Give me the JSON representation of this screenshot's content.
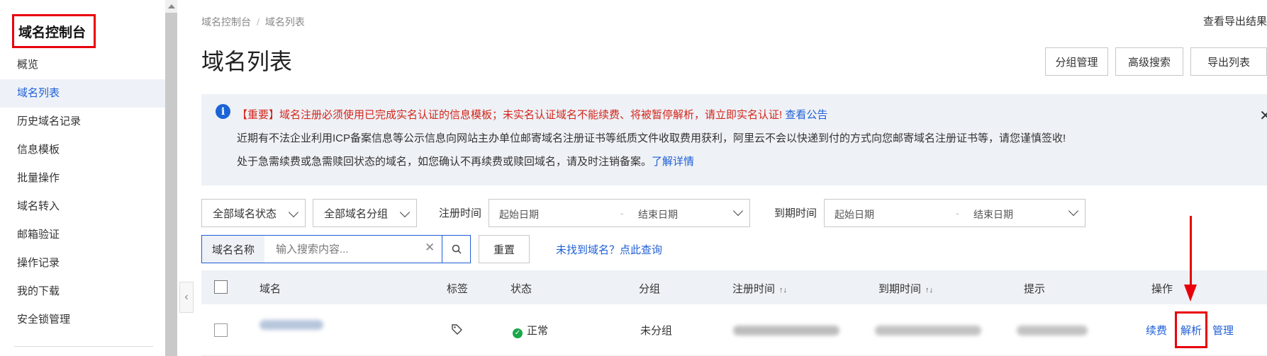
{
  "sidebar": {
    "title": "域名控制台",
    "items": [
      {
        "label": "概览"
      },
      {
        "label": "域名列表"
      },
      {
        "label": "历史域名记录"
      },
      {
        "label": "信息模板"
      },
      {
        "label": "批量操作"
      },
      {
        "label": "域名转入"
      },
      {
        "label": "邮箱验证"
      },
      {
        "label": "操作记录"
      },
      {
        "label": "我的下载"
      },
      {
        "label": "安全锁管理"
      }
    ]
  },
  "breadcrumb": {
    "root": "域名控制台",
    "sep": "/",
    "current": "域名列表"
  },
  "header": {
    "title": "域名列表",
    "export_results": "查看导出结果",
    "group_manage": "分组管理",
    "advanced_search": "高级搜索",
    "export_list": "导出列表"
  },
  "notice": {
    "line1": "【重要】域名注册必须使用已完成实名认证的信息模板；未实名认证域名不能续费、将被暂停解析，请立即实名认证!",
    "line1_link": "查看公告",
    "line2": "近期有不法企业利用ICP备案信息等公示信息向网站主办单位邮寄域名注册证书等纸质文件收取费用获利，阿里云不会以快递到付的方式向您邮寄域名注册证书等，请您谨慎签收!",
    "line3": "处于急需续费或急需赎回状态的域名，如您确认不再续费或赎回域名，请及时注销备案。",
    "line3_link": "了解详情"
  },
  "filters": {
    "status": "全部域名状态",
    "group": "全部域名分组",
    "reg_time_label": "注册时间",
    "exp_time_label": "到期时间",
    "start_date": "起始日期",
    "end_date": "结束日期",
    "dash": "-",
    "search_label": "域名名称",
    "search_placeholder": "输入搜索内容...",
    "reset": "重置",
    "not_found": "未找到域名？点此查询"
  },
  "table": {
    "headers": {
      "domain": "域名",
      "tags": "标签",
      "status": "状态",
      "group": "分组",
      "reg_time": "注册时间",
      "exp_time": "到期时间",
      "hint": "提示",
      "actions": "操作"
    },
    "rows": [
      {
        "status": "正常",
        "group": "未分组",
        "actions": {
          "renew": "续费",
          "resolve": "解析",
          "manage": "管理"
        }
      }
    ]
  },
  "colors": {
    "accent": "#1f5fd6",
    "highlight": "#e8000b",
    "success": "#1aa64a"
  }
}
